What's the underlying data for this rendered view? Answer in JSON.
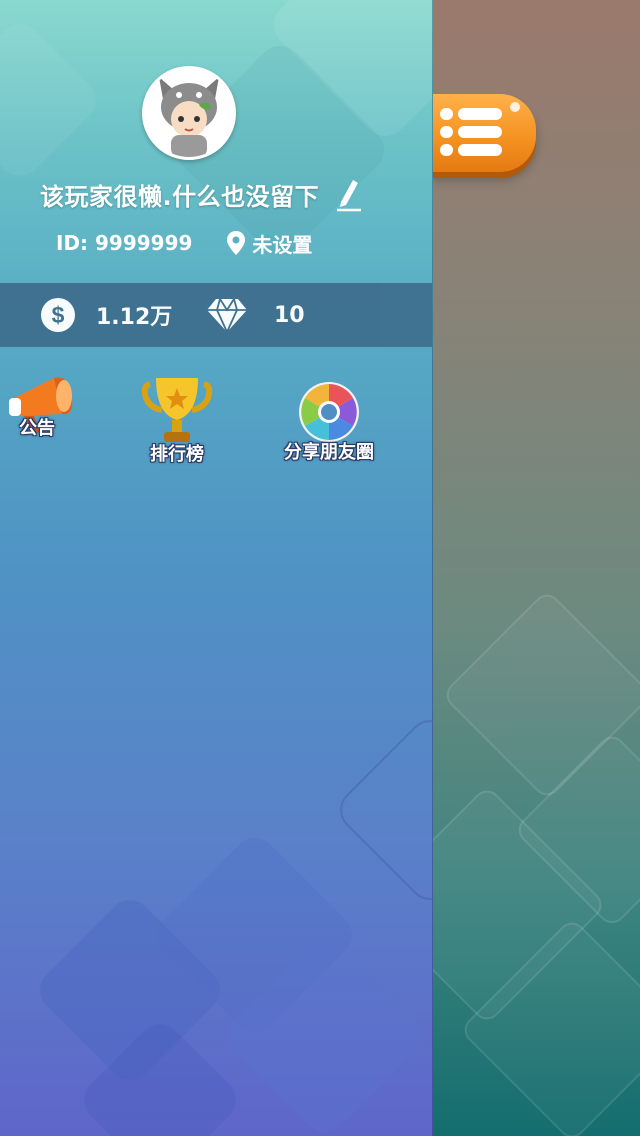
{
  "player": {
    "nickname": "该玩家很懒.什么也没留下",
    "id_label": "ID: 9999999",
    "location": "未设置"
  },
  "currency": {
    "gold_value": "1.12万",
    "diamond_value": "10"
  },
  "functions": {
    "notice_label": "公告",
    "ranking_label": "排行榜",
    "share_label": "分享朋友圈"
  },
  "icons": {
    "edit": "pencil-icon",
    "location": "location-pin-icon",
    "gold": "dollar-coin-icon",
    "diamond": "diamond-icon",
    "notice": "megaphone-icon",
    "ranking": "trophy-icon",
    "share": "camera-shutter-icon",
    "menu": "list-menu-icon"
  },
  "colors": {
    "menu_button": "#f59322",
    "stats_bar": "#3f6f8f",
    "drawer_top": "#8ad9cf",
    "drawer_bottom": "#5f66c9"
  }
}
